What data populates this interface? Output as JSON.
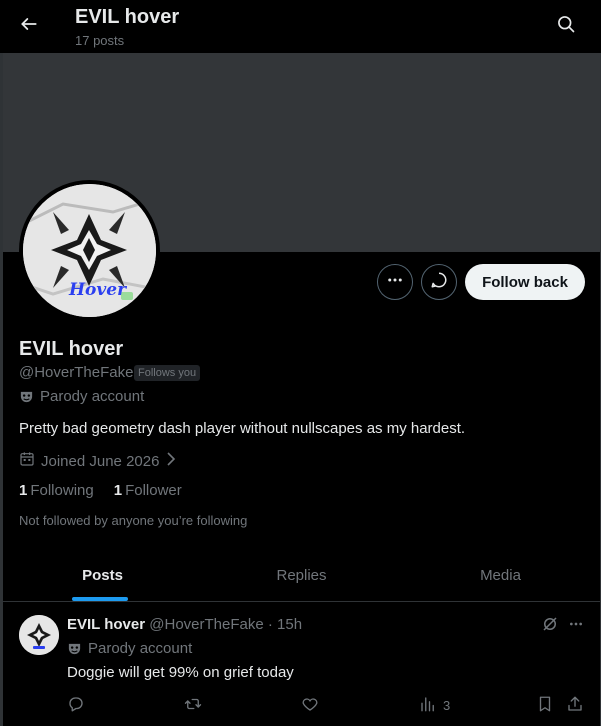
{
  "header": {
    "title": "EVIL hover",
    "post_count": "17 posts"
  },
  "profile": {
    "name": "EVIL hover",
    "handle": "@HoverTheFake",
    "follows_badge": "Follows you",
    "parody_label": "Parody account",
    "bio": "Pretty bad geometry dash player without nullscapes as my hardest.",
    "joined": "Joined June 2026",
    "following_count": "1",
    "following_label": "Following",
    "follower_count": "1",
    "follower_label": "Follower",
    "not_followed": "Not followed by anyone you’re following",
    "avatar_text": "Hover",
    "follow_button": "Follow back"
  },
  "tabs": [
    {
      "label": "Posts",
      "active": true
    },
    {
      "label": "Replies",
      "active": false
    },
    {
      "label": "Media",
      "active": false
    }
  ],
  "post": {
    "name": "EVIL hover",
    "handle": "@HoverTheFake",
    "separator": "·",
    "time": "15h",
    "parody_label": "Parody account",
    "text": "Doggie will get 99% on grief today",
    "views": "3"
  },
  "colors": {
    "background": "#000000",
    "banner": "#333639",
    "accent": "#1d9bf0",
    "muted": "#71767b",
    "text": "#e7e9ea"
  },
  "icons": {
    "back": "arrow-left-icon",
    "search": "search-icon",
    "more": "ellipsis-icon",
    "message": "message-icon",
    "calendar": "calendar-icon",
    "parody": "parody-mask-icon",
    "grok": "grok-icon",
    "reply": "reply-icon",
    "repost": "repost-icon",
    "like": "heart-icon",
    "views": "views-chart-icon",
    "bookmark": "bookmark-icon",
    "share": "share-icon"
  }
}
